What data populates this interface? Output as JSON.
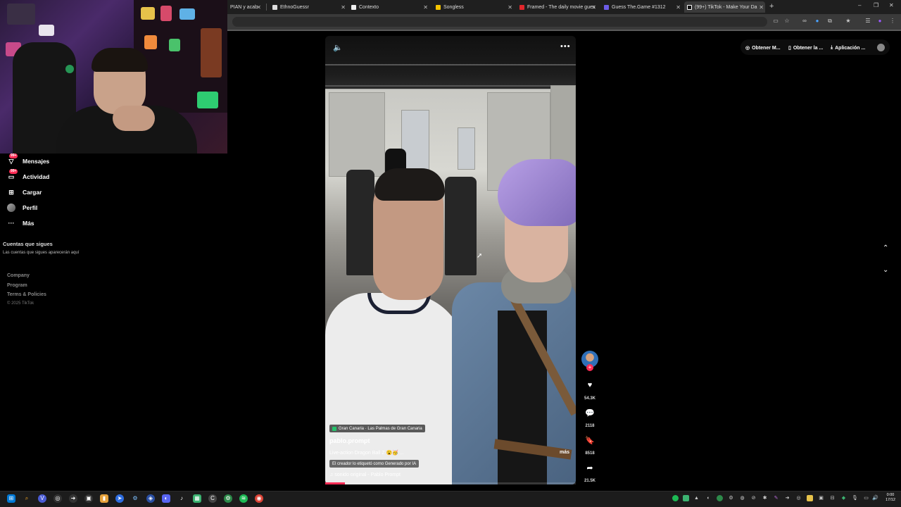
{
  "browser": {
    "tabs": [
      {
        "label": "PIAN y acab",
        "color": "#888"
      },
      {
        "label": "EthnoGuessr",
        "color": "#ddd"
      },
      {
        "label": "Contexto",
        "color": "#eee"
      },
      {
        "label": "Songless",
        "color": "#f5c400"
      },
      {
        "label": "Framed - The daily movie gues",
        "color": "#e2262b"
      },
      {
        "label": "Guess The.Game #1312",
        "color": "#6c5ce7"
      },
      {
        "label": "(99+) TikTok - Make Your Da",
        "color": "#111"
      }
    ],
    "new_tab": "+",
    "window_controls": [
      "–",
      "❐",
      "✕"
    ]
  },
  "sidebar": {
    "items": [
      {
        "label": "Mensajes",
        "icon": "messages-icon",
        "badge": "99+"
      },
      {
        "label": "Actividad",
        "icon": "activity-icon",
        "badge": "99+"
      },
      {
        "label": "Cargar",
        "icon": "upload-icon"
      },
      {
        "label": "Perfil",
        "icon": "profile-avatar"
      },
      {
        "label": "Más",
        "icon": "more-icon"
      }
    ],
    "following_title": "Cuentas que sigues",
    "following_desc": "Las cuentas que sigues aparecerán aquí",
    "footer": [
      "Company",
      "Program",
      "Terms & Policies"
    ],
    "copyright": "© 2025 TikTok"
  },
  "video": {
    "location": "Gran Canaria · Las Palmas de Gran Canaria",
    "author": "pablo.prompt",
    "caption": "Live-action Dragon Ball Z 😮🥳 ...",
    "more": "más",
    "ai_label": "El creador lo etiquetó como Generado por IA",
    "sound_icon": "♫",
    "sound": "sonido original - Pablo Prompt",
    "progress": 0.08,
    "accent": "#fe2c55"
  },
  "actions": {
    "likes": "54.3K",
    "comments": "2118",
    "saves": "8518",
    "shares": "21.5K"
  },
  "extensions": [
    {
      "label": "Obtener M..."
    },
    {
      "label": "Obtener la ..."
    },
    {
      "label": "Aplicación ..."
    }
  ],
  "clock": {
    "time": "0:00",
    "date": "17/12"
  }
}
